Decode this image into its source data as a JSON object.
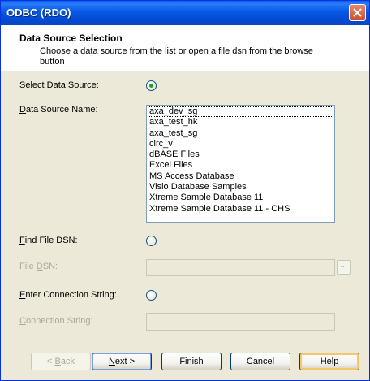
{
  "window": {
    "title": "ODBC (RDO)"
  },
  "header": {
    "title": "Data Source Selection",
    "description": "Choose a data source from the list or open a file dsn from the browse button"
  },
  "select_data_source": {
    "label_mnemonic": "S",
    "label_rest": "elect Data Source:",
    "selected": true
  },
  "data_source_name": {
    "label_mnemonic": "D",
    "label_rest": "ata Source Name:",
    "items": [
      "axa_dev_sg",
      "axa_test_hk",
      "axa_test_sg",
      "circ_v",
      "dBASE Files",
      "Excel Files",
      "MS Access Database",
      "Visio Database Samples",
      "Xtreme Sample Database 11",
      "Xtreme Sample Database 11 - CHS"
    ],
    "focused_item": "axa_dev_sg"
  },
  "find_file_dsn": {
    "label_mnemonic": "F",
    "label_rest": "ind File DSN:",
    "selected": false
  },
  "file_dsn": {
    "label_pre": "File ",
    "label_mnemonic": "D",
    "label_rest": "SN:",
    "value": "",
    "browse_label": "..."
  },
  "enter_connection_string": {
    "label_mnemonic": "E",
    "label_rest": "nter Connection String:",
    "selected": false
  },
  "connection_string": {
    "label_mnemonic": "C",
    "label_rest": "onnection String:",
    "value": ""
  },
  "buttons": {
    "back_prefix": "< ",
    "back_mnemonic": "B",
    "back_rest": "ack",
    "next_mnemonic": "N",
    "next_rest": "ext >",
    "finish": "Finish",
    "cancel": "Cancel",
    "help": "Help"
  }
}
